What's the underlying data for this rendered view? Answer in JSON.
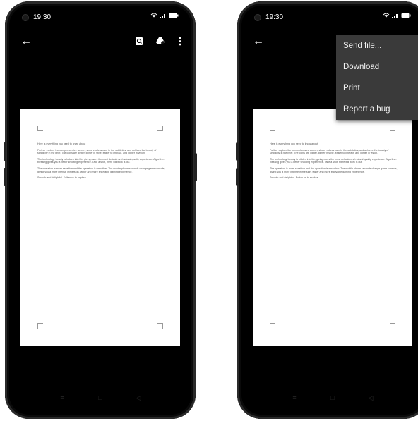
{
  "status": {
    "time": "19:30"
  },
  "document": {
    "paragraphs": [
      "Here is everything you need to know about",
      "Further explore the comprehensive screen, show endless care in the subtleties, and achieve the beauty of simplicity in the brief. The icons are lighter, lighter in style, easier to interact, and lighter in vision.",
      "The technology beauty is hidden into life, giving users the most delicate and natural quality experience. Algorithm blessing gives you a better shooting experience. Take a shot, there will work is out.",
      "The operation is more sensitive and the operation is smoother. The mobile phone seconds change game console, giving you a more intense immersion, faster and more enjoyable gaming experience.",
      "Smooth and delightful. Follow us to explore."
    ]
  },
  "menu": {
    "items": [
      "Send file...",
      "Download",
      "Print",
      "Report a bug"
    ]
  },
  "icons": {
    "back": "back-arrow-icon",
    "search": "doc-search-icon",
    "drive": "drive-add-icon",
    "more": "more-vert-icon"
  }
}
